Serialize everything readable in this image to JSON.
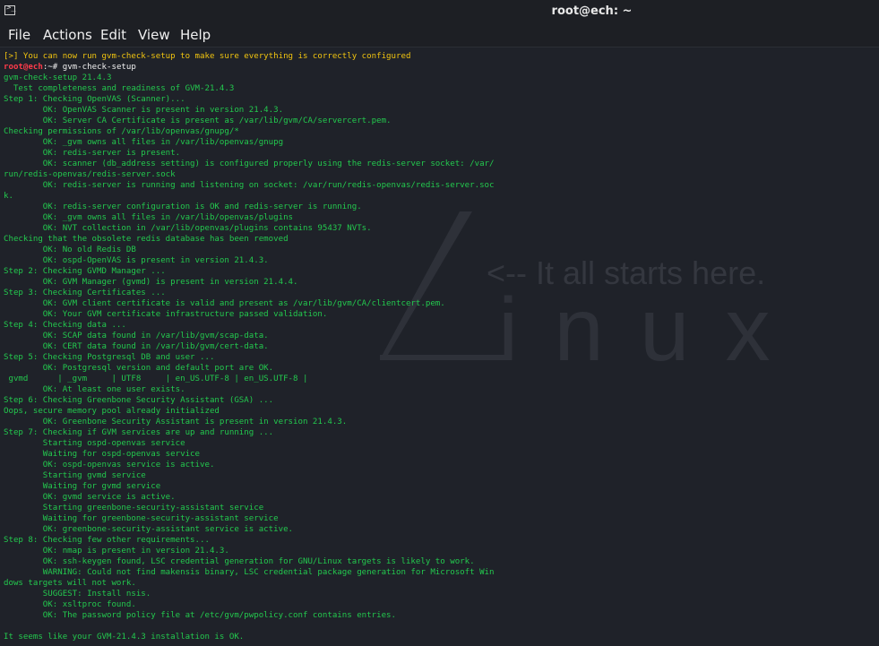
{
  "window": {
    "title": "root@ech: ~",
    "icon": "terminal-icon"
  },
  "menu": [
    "File",
    "Actions",
    "Edit",
    "View",
    "Help"
  ],
  "wallpaper": {
    "tagline": "<-- It all starts here.",
    "brand": "inux"
  },
  "prompt": {
    "user": "root@ech",
    "sep": ":~# ",
    "command": "gvm-check-setup"
  },
  "notice": {
    "mark": "[>]",
    "text": " You can now run gvm-check-setup to make sure everything is correctly configured"
  },
  "output": [
    "gvm-check-setup 21.4.3",
    "  Test completeness and readiness of GVM-21.4.3",
    "Step 1: Checking OpenVAS (Scanner)...",
    "        OK: OpenVAS Scanner is present in version 21.4.3.",
    "        OK: Server CA Certificate is present as /var/lib/gvm/CA/servercert.pem.",
    "Checking permissions of /var/lib/openvas/gnupg/*",
    "        OK: _gvm owns all files in /var/lib/openvas/gnupg",
    "        OK: redis-server is present.",
    "        OK: scanner (db_address setting) is configured properly using the redis-server socket: /var/",
    "run/redis-openvas/redis-server.sock",
    "        OK: redis-server is running and listening on socket: /var/run/redis-openvas/redis-server.soc",
    "k.",
    "        OK: redis-server configuration is OK and redis-server is running.",
    "        OK: _gvm owns all files in /var/lib/openvas/plugins",
    "        OK: NVT collection in /var/lib/openvas/plugins contains 95437 NVTs.",
    "Checking that the obsolete redis database has been removed",
    "        OK: No old Redis DB",
    "        OK: ospd-OpenVAS is present in version 21.4.3.",
    "Step 2: Checking GVMD Manager ...",
    "        OK: GVM Manager (gvmd) is present in version 21.4.4.",
    "Step 3: Checking Certificates ...",
    "        OK: GVM client certificate is valid and present as /var/lib/gvm/CA/clientcert.pem.",
    "        OK: Your GVM certificate infrastructure passed validation.",
    "Step 4: Checking data ...",
    "        OK: SCAP data found in /var/lib/gvm/scap-data.",
    "        OK: CERT data found in /var/lib/gvm/cert-data.",
    "Step 5: Checking Postgresql DB and user ...",
    "        OK: Postgresql version and default port are OK.",
    " gvmd      | _gvm     | UTF8     | en_US.UTF-8 | en_US.UTF-8 |",
    "        OK: At least one user exists.",
    "Step 6: Checking Greenbone Security Assistant (GSA) ...",
    "Oops, secure memory pool already initialized",
    "        OK: Greenbone Security Assistant is present in version 21.4.3.",
    "Step 7: Checking if GVM services are up and running ...",
    "        Starting ospd-openvas service",
    "        Waiting for ospd-openvas service",
    "        OK: ospd-openvas service is active.",
    "        Starting gvmd service",
    "        Waiting for gvmd service",
    "        OK: gvmd service is active.",
    "        Starting greenbone-security-assistant service",
    "        Waiting for greenbone-security-assistant service",
    "        OK: greenbone-security-assistant service is active.",
    "Step 8: Checking few other requirements...",
    "        OK: nmap is present in version 21.4.3.",
    "        OK: ssh-keygen found, LSC credential generation for GNU/Linux targets is likely to work.",
    "        WARNING: Could not find makensis binary, LSC credential package generation for Microsoft Win",
    "dows targets will not work.",
    "        SUGGEST: Install nsis.",
    "        OK: xsltproc found.",
    "        OK: The password policy file at /etc/gvm/pwpolicy.conf contains entries.",
    "",
    "It seems like your GVM-21.4.3 installation is OK."
  ]
}
